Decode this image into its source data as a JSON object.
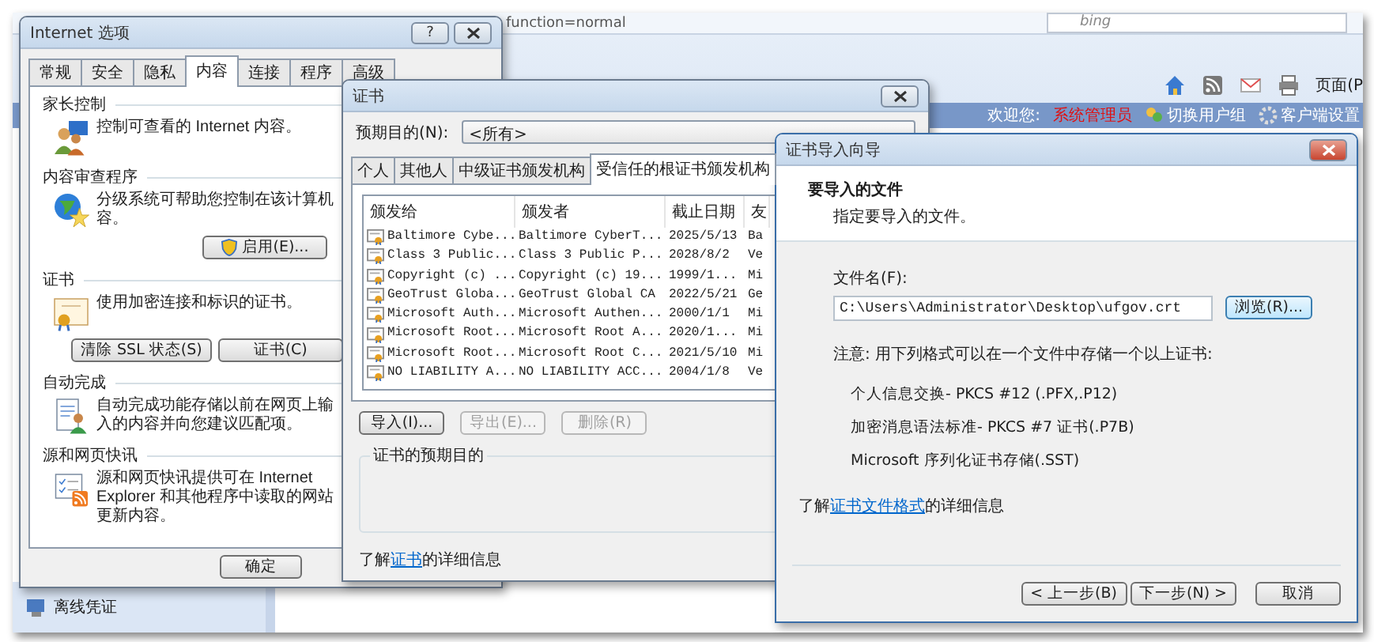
{
  "browser": {
    "address_text": "function=normal",
    "search_placeholder": "bing",
    "page_menu": "页面(P",
    "welcome": "欢迎您:",
    "user": "系统管理员",
    "links": [
      "切换用户组",
      "客户端设置"
    ],
    "sidebar_items": [
      "离线凭证"
    ]
  },
  "internet_options": {
    "title": "Internet 选项",
    "help_glyph": "?",
    "tabs": [
      {
        "label": "常规",
        "selected": false
      },
      {
        "label": "安全",
        "selected": false
      },
      {
        "label": "隐私",
        "selected": false
      },
      {
        "label": "内容",
        "selected": true
      },
      {
        "label": "连接",
        "selected": false
      },
      {
        "label": "程序",
        "selected": false
      },
      {
        "label": "高级",
        "selected": false
      }
    ],
    "sections": [
      {
        "kind": "parental",
        "heading": "家长控制",
        "lines": [
          "控制可查看的 Internet 内容。"
        ]
      },
      {
        "kind": "advisor",
        "heading": "内容审查程序",
        "lines": [
          "分级系统可帮助您控制在该计算机",
          "容。"
        ],
        "buttons": [
          {
            "label": "启用(E)...",
            "shield": true
          }
        ]
      },
      {
        "kind": "certificate",
        "heading": "证书",
        "lines": [
          "使用加密连接和标识的证书。"
        ],
        "buttons": [
          {
            "label": "清除 SSL 状态(S)",
            "shield": false
          },
          {
            "label": "证书(C)",
            "shield": false
          }
        ]
      },
      {
        "kind": "autocomplete",
        "heading": "自动完成",
        "lines": [
          "自动完成功能存储以前在网页上输",
          "入的内容并向您建议匹配项。"
        ]
      },
      {
        "kind": "feeds",
        "heading": "源和网页快讯",
        "lines": [
          "源和网页快讯提供可在 Internet",
          "Explorer 和其他程序中读取的网站",
          "更新内容。"
        ]
      }
    ],
    "buttons": [
      "确定"
    ]
  },
  "certificates": {
    "title": "证书",
    "purpose_label": "预期目的(N):",
    "purpose_value": "<所有>",
    "tabs": [
      {
        "label": "个人",
        "selected": false
      },
      {
        "label": "其他人",
        "selected": false
      },
      {
        "label": "中级证书颁发机构",
        "selected": false
      },
      {
        "label": "受信任的根证书颁发机构",
        "selected": true
      }
    ],
    "columns": [
      "颁发给",
      "颁发者",
      "截止日期",
      "友"
    ],
    "rows": [
      [
        "Baltimore Cybe...",
        "Baltimore CyberT...",
        "2025/5/13",
        "Ba"
      ],
      [
        "Class 3 Public...",
        "Class 3 Public P...",
        "2028/8/2",
        "Ve"
      ],
      [
        "Copyright (c) ...",
        "Copyright (c) 19...",
        "1999/1...",
        "Mi"
      ],
      [
        "GeoTrust Globa...",
        "GeoTrust Global CA",
        "2022/5/21",
        "Ge"
      ],
      [
        "Microsoft Auth...",
        "Microsoft Authen...",
        "2000/1/1",
        "Mi"
      ],
      [
        "Microsoft Root...",
        "Microsoft Root A...",
        "2020/1...",
        "Mi"
      ],
      [
        "Microsoft Root...",
        "Microsoft Root C...",
        "2021/5/10",
        "Mi"
      ],
      [
        "NO LIABILITY A...",
        "NO LIABILITY ACC...",
        "2004/1/8",
        "Ve"
      ]
    ],
    "buttons": [
      {
        "label": "导入(I)...",
        "disabled": false
      },
      {
        "label": "导出(E)...",
        "disabled": true
      },
      {
        "label": "删除(R)",
        "disabled": true
      }
    ],
    "group_title": "证书的预期目的",
    "footer": {
      "before": "了解",
      "link": "证书",
      "after": "的详细信息"
    }
  },
  "wizard": {
    "title": "证书导入向导",
    "heading": "要导入的文件",
    "subheading": "指定要导入的文件。",
    "file_label": "文件名(F):",
    "file_value": "C:\\Users\\Administrator\\Desktop\\ufgov.crt",
    "browse_button": "浏览(R)...",
    "note": "注意: 用下列格式可以在一个文件中存储一个以上证书:",
    "formats": [
      "个人信息交换- PKCS #12 (.PFX,.P12)",
      "加密消息语法标准- PKCS #7 证书(.P7B)",
      "Microsoft 序列化证书存储(.SST)"
    ],
    "footer": {
      "before": "了解",
      "link": "证书文件格式",
      "after": "的详细信息"
    },
    "buttons": [
      {
        "label": "< 上一步(B)",
        "kind": "nav"
      },
      {
        "label": "下一步(N) >",
        "kind": "nav"
      },
      {
        "label": "取消",
        "kind": "cancel"
      }
    ]
  }
}
